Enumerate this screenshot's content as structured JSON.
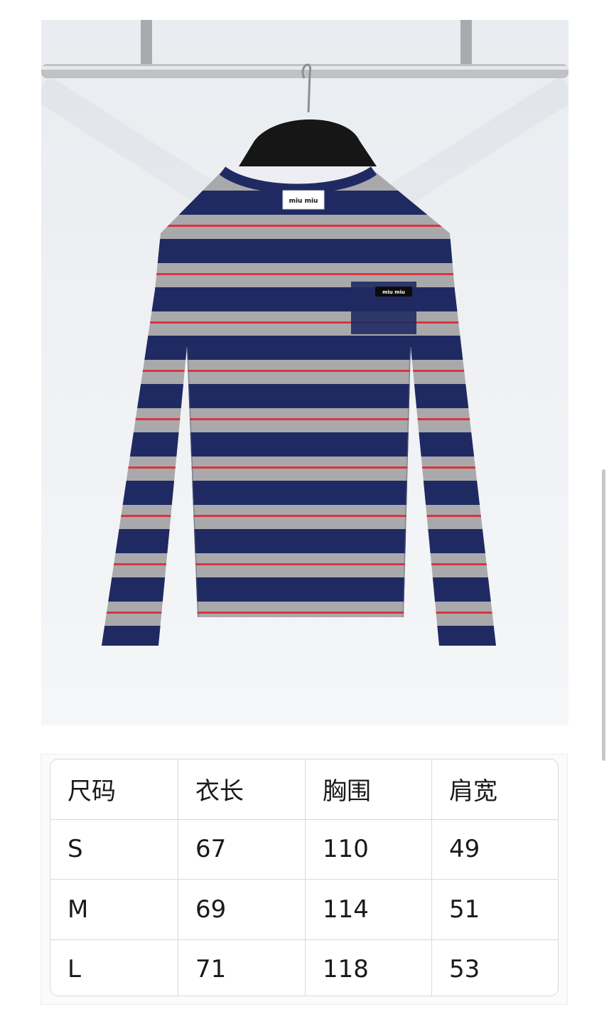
{
  "product_photo": {
    "description_icon": "striped-long-sleeve-shirt-photo",
    "label_text": "miu miu",
    "colors": {
      "navy": "#202a62",
      "gray": "#a9a9ab",
      "red": "#d8353e",
      "wall": "#f1f3f6"
    }
  },
  "size_table": {
    "headers": [
      "尺码",
      "衣长",
      "胸围",
      "肩宽"
    ],
    "rows": [
      [
        "S",
        "67",
        "110",
        "49"
      ],
      [
        "M",
        "69",
        "114",
        "51"
      ],
      [
        "L",
        "71",
        "118",
        "53"
      ]
    ]
  }
}
